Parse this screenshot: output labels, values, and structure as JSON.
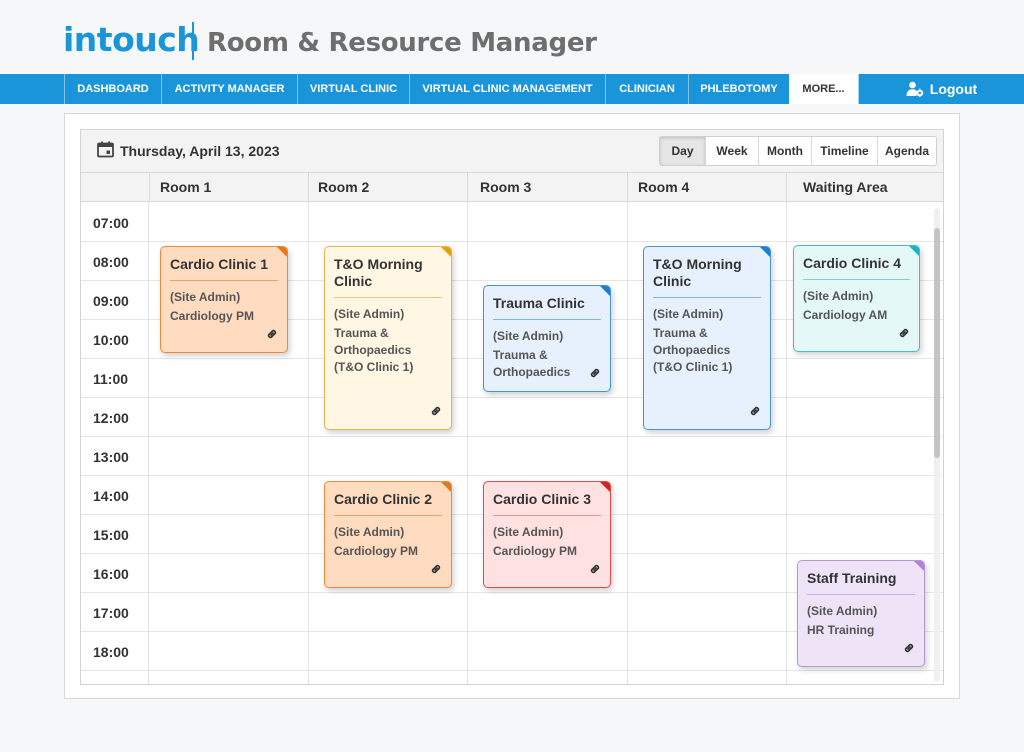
{
  "app": {
    "logo": "intouch",
    "title": "Room & Resource Manager"
  },
  "nav": {
    "items": [
      {
        "label": "DASHBOARD"
      },
      {
        "label": "ACTIVITY MANAGER"
      },
      {
        "label": "VIRTUAL CLINIC"
      },
      {
        "label": "VIRTUAL CLINIC MANAGEMENT"
      },
      {
        "label": "CLINICIAN"
      },
      {
        "label": "PHLEBOTOMY"
      },
      {
        "label": "MORE..."
      }
    ],
    "active": "MORE...",
    "logout_label": "Logout",
    "accent": "#1a95da"
  },
  "scheduler": {
    "date": "Thursday, April 13, 2023",
    "views": [
      {
        "label": "Day"
      },
      {
        "label": "Week"
      },
      {
        "label": "Month"
      },
      {
        "label": "Timeline"
      },
      {
        "label": "Agenda"
      }
    ],
    "active_view": "Day",
    "resources": [
      {
        "label": "Room 1"
      },
      {
        "label": "Room 2"
      },
      {
        "label": "Room 3"
      },
      {
        "label": "Room 4"
      },
      {
        "label": "Waiting Area"
      }
    ],
    "times": [
      "07:00",
      "08:00",
      "09:00",
      "10:00",
      "11:00",
      "12:00",
      "13:00",
      "14:00",
      "15:00",
      "16:00",
      "17:00",
      "18:00"
    ],
    "events": [
      {
        "title": "Cardio Clinic 1",
        "owner": "(Site Admin)",
        "desc": "Cardiology PM",
        "resource": "Room 1",
        "color": "orange",
        "icon": "link-icon"
      },
      {
        "title": "T&O Morning Clinic",
        "owner": "(Site Admin)",
        "desc": "Trauma & Orthopaedics (T&O Clinic 1)",
        "resource": "Room 2",
        "color": "yellow",
        "icon": "link-icon"
      },
      {
        "title": "Trauma Clinic",
        "owner": "(Site Admin)",
        "desc": "Trauma & Orthopaedics",
        "resource": "Room 3",
        "color": "blue",
        "icon": "link-icon"
      },
      {
        "title": "T&O Morning Clinic",
        "owner": "(Site Admin)",
        "desc": "Trauma & Orthopaedics (T&O Clinic 1)",
        "resource": "Room 4",
        "color": "blue",
        "icon": "link-icon"
      },
      {
        "title": "Cardio Clinic 4",
        "owner": "(Site Admin)",
        "desc": "Cardiology AM",
        "resource": "Waiting Area",
        "color": "teal",
        "icon": "link-icon"
      },
      {
        "title": "Cardio Clinic 2",
        "owner": "(Site Admin)",
        "desc": "Cardiology PM",
        "resource": "Room 2",
        "color": "orange",
        "icon": "link-icon"
      },
      {
        "title": "Cardio Clinic 3",
        "owner": "(Site Admin)",
        "desc": "Cardiology PM",
        "resource": "Room 3",
        "color": "red",
        "icon": "link-icon"
      },
      {
        "title": "Staff Training",
        "owner": "(Site Admin)",
        "desc": "HR Training",
        "resource": "Waiting Area",
        "color": "purple",
        "icon": "link-icon"
      }
    ]
  }
}
